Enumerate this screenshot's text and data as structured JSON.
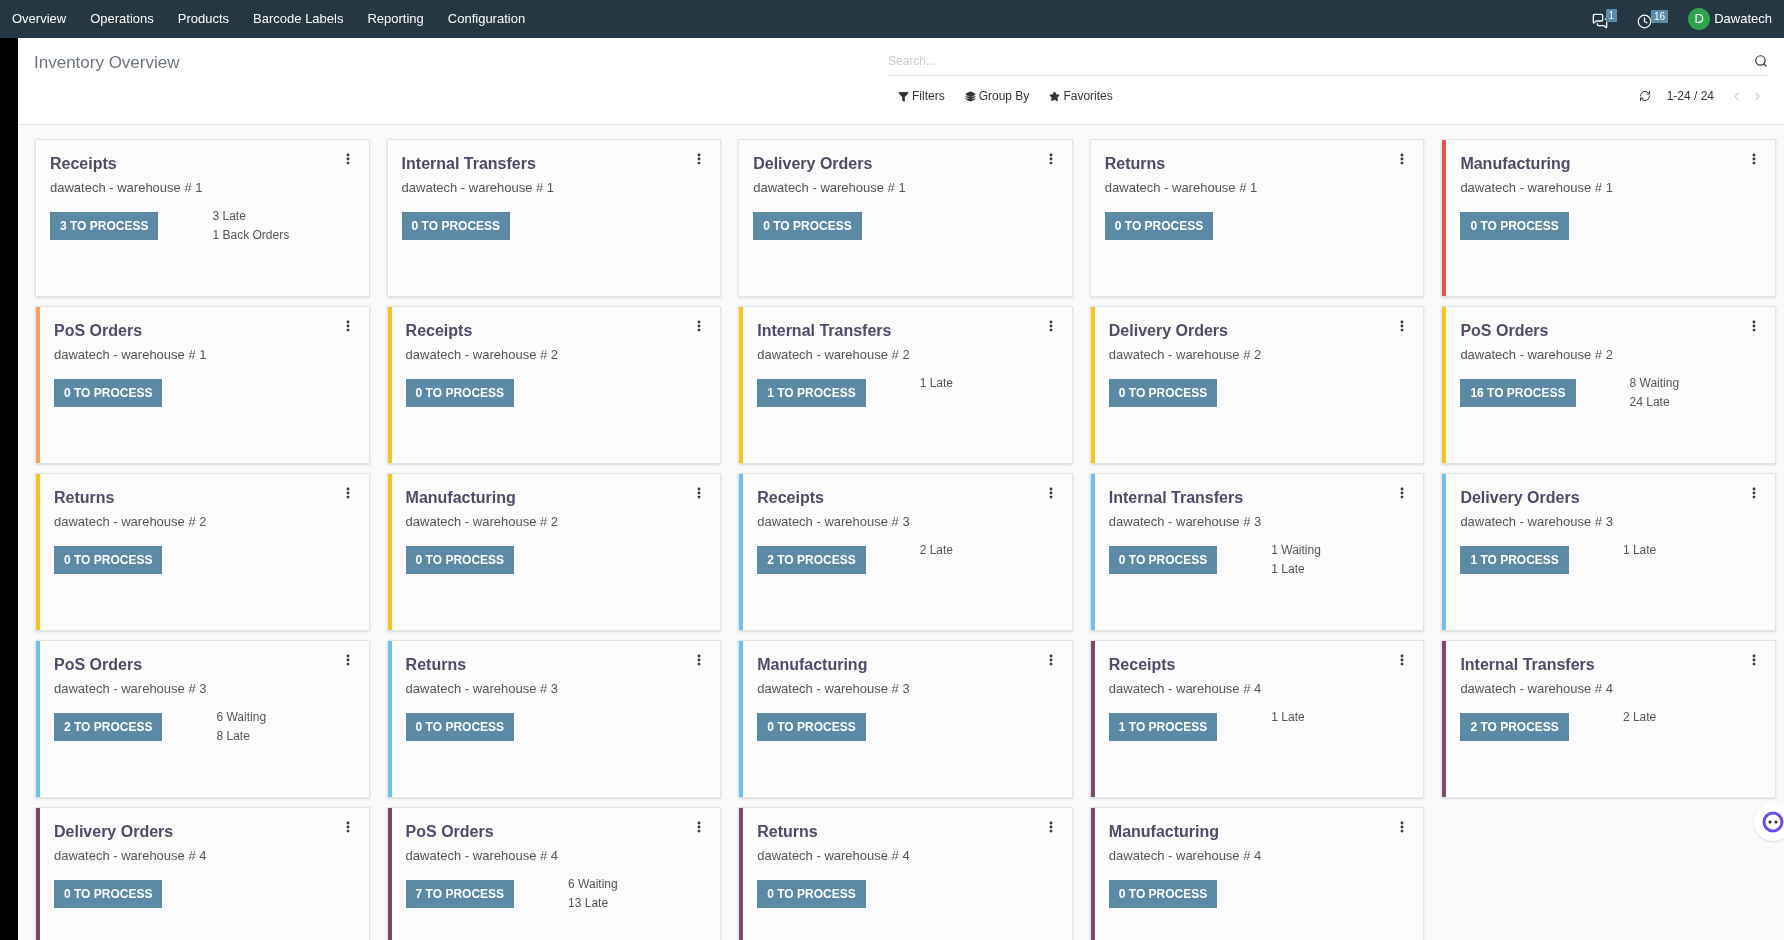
{
  "navbar": {
    "menu": [
      "Overview",
      "Operations",
      "Products",
      "Barcode Labels",
      "Reporting",
      "Configuration"
    ],
    "messages_count": "1",
    "activities_count": "16",
    "avatar_letter": "D",
    "user": "Dawatech"
  },
  "control_panel": {
    "title": "Inventory Overview",
    "search": {
      "placeholder": "Search..."
    },
    "filters": [
      "Filters",
      "Group By",
      "Favorites"
    ],
    "pager": "1-24 / 24"
  },
  "cards": [
    {
      "title": "Receipts",
      "subtitle": "dawatech - warehouse # 1",
      "button": "3 TO PROCESS",
      "stats": [
        "3 Late",
        "1 Back Orders"
      ]
    },
    {
      "title": "Internal Transfers",
      "subtitle": "dawatech - warehouse # 1",
      "button": "0 TO PROCESS"
    },
    {
      "title": "Delivery Orders",
      "subtitle": "dawatech - warehouse # 1",
      "button": "0 TO PROCESS"
    },
    {
      "title": "Returns",
      "subtitle": "dawatech - warehouse # 1",
      "button": "0 TO PROCESS"
    },
    {
      "title": "Manufacturing",
      "subtitle": "dawatech - warehouse # 1",
      "button": "0 TO PROCESS",
      "color": "#e8584d"
    },
    {
      "title": "PoS Orders",
      "subtitle": "dawatech - warehouse # 1",
      "button": "0 TO PROCESS",
      "color": "#f4a460"
    },
    {
      "title": "Receipts",
      "subtitle": "dawatech - warehouse # 2",
      "button": "0 TO PROCESS",
      "color": "#f5c518"
    },
    {
      "title": "Internal Transfers",
      "subtitle": "dawatech - warehouse # 2",
      "button": "1 TO PROCESS",
      "stats": [
        "1 Late"
      ],
      "color": "#f5c518"
    },
    {
      "title": "Delivery Orders",
      "subtitle": "dawatech - warehouse # 2",
      "button": "0 TO PROCESS",
      "color": "#f5c518"
    },
    {
      "title": "PoS Orders",
      "subtitle": "dawatech - warehouse # 2",
      "button": "16 TO PROCESS",
      "stats": [
        "8 Waiting",
        "24 Late"
      ],
      "color": "#f5c518"
    },
    {
      "title": "Returns",
      "subtitle": "dawatech - warehouse # 2",
      "button": "0 TO PROCESS",
      "color": "#f5c518"
    },
    {
      "title": "Manufacturing",
      "subtitle": "dawatech - warehouse # 2",
      "button": "0 TO PROCESS",
      "color": "#f5c518"
    },
    {
      "title": "Receipts",
      "subtitle": "dawatech - warehouse # 3",
      "button": "2 TO PROCESS",
      "stats": [
        "2 Late"
      ],
      "color": "#6cc1ed"
    },
    {
      "title": "Internal Transfers",
      "subtitle": "dawatech - warehouse # 3",
      "button": "0 TO PROCESS",
      "stats": [
        "1 Waiting",
        "1 Late"
      ],
      "color": "#6cc1ed"
    },
    {
      "title": "Delivery Orders",
      "subtitle": "dawatech - warehouse # 3",
      "button": "1 TO PROCESS",
      "stats": [
        "1 Late"
      ],
      "color": "#6cc1ed"
    },
    {
      "title": "PoS Orders",
      "subtitle": "dawatech - warehouse # 3",
      "button": "2 TO PROCESS",
      "stats": [
        "6 Waiting",
        "8 Late"
      ],
      "color": "#6cc1ed"
    },
    {
      "title": "Returns",
      "subtitle": "dawatech - warehouse # 3",
      "button": "0 TO PROCESS",
      "color": "#6cc1ed"
    },
    {
      "title": "Manufacturing",
      "subtitle": "dawatech - warehouse # 3",
      "button": "0 TO PROCESS",
      "color": "#6cc1ed"
    },
    {
      "title": "Receipts",
      "subtitle": "dawatech - warehouse # 4",
      "button": "1 TO PROCESS",
      "stats": [
        "1 Late"
      ],
      "color": "#7c4a68"
    },
    {
      "title": "Internal Transfers",
      "subtitle": "dawatech - warehouse # 4",
      "button": "2 TO PROCESS",
      "stats": [
        "2 Late"
      ],
      "color": "#7c4a68"
    },
    {
      "title": "Delivery Orders",
      "subtitle": "dawatech - warehouse # 4",
      "button": "0 TO PROCESS",
      "color": "#7c4a68"
    },
    {
      "title": "PoS Orders",
      "subtitle": "dawatech - warehouse # 4",
      "button": "7 TO PROCESS",
      "stats": [
        "6 Waiting",
        "13 Late"
      ],
      "color": "#7c4a68"
    },
    {
      "title": "Returns",
      "subtitle": "dawatech - warehouse # 4",
      "button": "0 TO PROCESS",
      "color": "#7c4a68"
    },
    {
      "title": "Manufacturing",
      "subtitle": "dawatech - warehouse # 4",
      "button": "0 TO PROCESS",
      "color": "#7c4a68"
    }
  ]
}
